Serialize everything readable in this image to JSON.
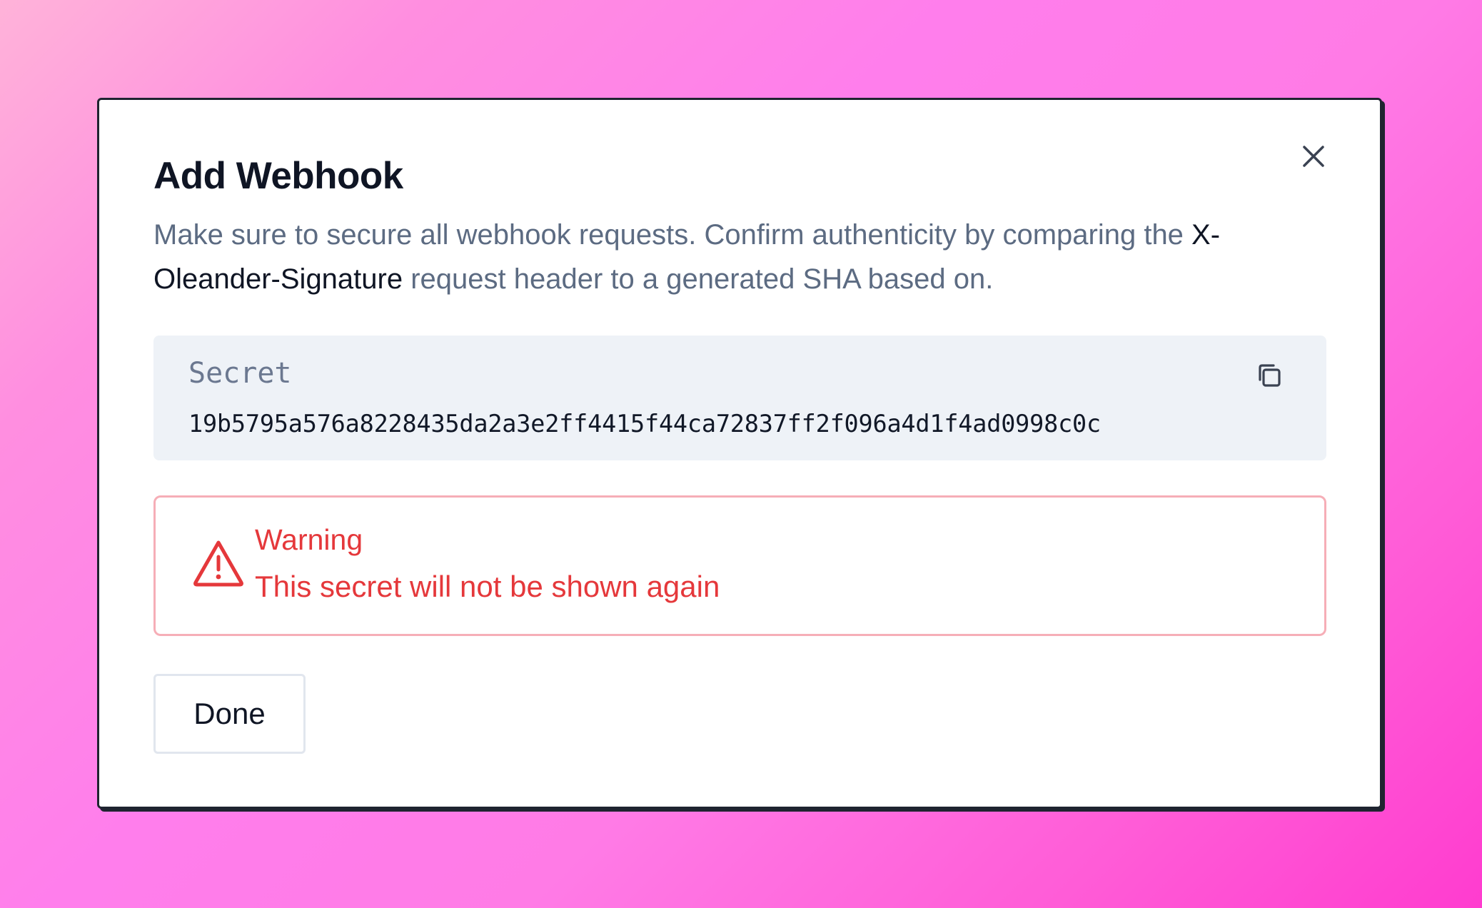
{
  "modal": {
    "title": "Add Webhook",
    "description_part1": "Make sure to secure all webhook requests. Confirm authenticity by comparing the ",
    "description_header_name": "X-Oleander-Signature",
    "description_part2": " request header to a generated SHA based on.",
    "close_icon": "close-icon"
  },
  "secret": {
    "label": "Secret",
    "value": "19b5795a576a8228435da2a3e2ff4415f44ca72837ff2f096a4d1f4ad0998c0c",
    "copy_icon": "copy-icon"
  },
  "warning": {
    "title": "Warning",
    "message": "This secret will not be shown again",
    "icon": "warning-triangle-icon",
    "color": "#e5383b"
  },
  "actions": {
    "done_label": "Done"
  }
}
